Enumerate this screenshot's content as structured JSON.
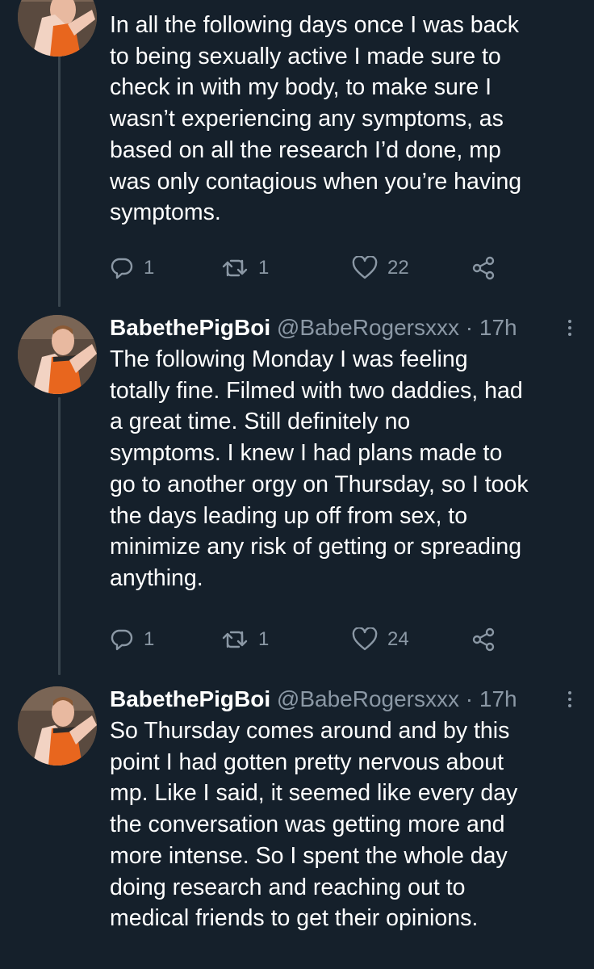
{
  "tweets": [
    {
      "name": "",
      "handle": "",
      "time": "",
      "lines": [
        "In all the following days once I was back",
        "to being sexually active I made sure to",
        "check in with my body, to make sure I",
        "wasn’t experiencing any symptoms, as",
        "based on all the research I’d done, mp",
        "was only contagious when you’re having",
        "symptoms."
      ],
      "replies": "1",
      "retweets": "1",
      "likes": "22"
    },
    {
      "name": "BabethePigBoi",
      "handle": "@BabeRogersxxx",
      "time": "· 17h",
      "lines": [
        "The following Monday I was feeling",
        "totally fine. Filmed with two daddies, had",
        "a great time. Still definitely no",
        "symptoms. I knew I had plans made to",
        "go to another orgy on Thursday, so I took",
        "the days leading up off from sex, to",
        "minimize any risk of getting or spreading",
        "anything."
      ],
      "replies": "1",
      "retweets": "1",
      "likes": "24"
    },
    {
      "name": "BabethePigBoi",
      "handle": "@BabeRogersxxx",
      "time": "· 17h",
      "lines": [
        "So Thursday comes around and by this",
        "point I had gotten pretty nervous about",
        "mp. Like I said, it seemed like every day",
        "the conversation was getting more and",
        "more intense. So I spent the whole day",
        "doing research and reaching out to",
        "medical friends to get their opinions."
      ]
    }
  ],
  "icons": {
    "reply": "reply-icon",
    "retweet": "retweet-icon",
    "like": "heart-icon",
    "share": "share-icon",
    "more": "more-icon"
  },
  "colors": {
    "background": "#15202b",
    "text": "#ffffff",
    "secondary": "#8b98a5",
    "thread_line": "#38444d"
  }
}
